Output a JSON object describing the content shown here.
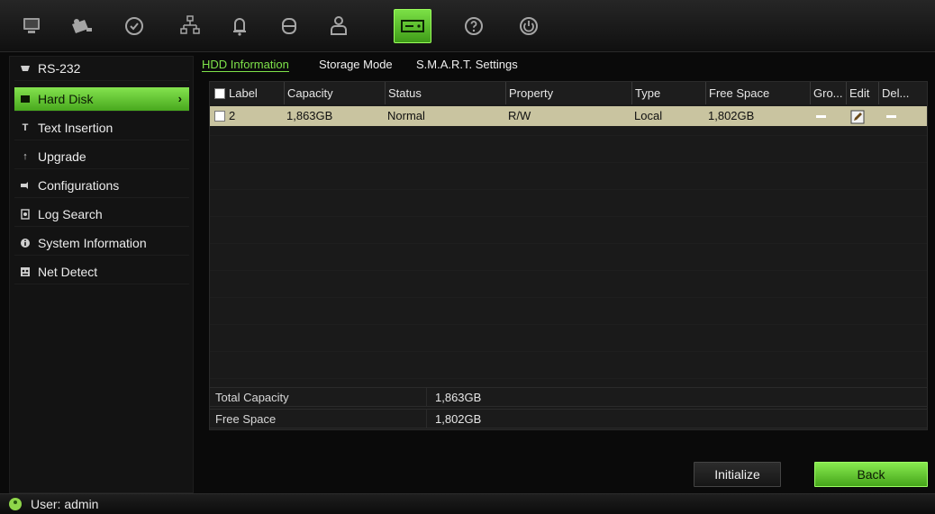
{
  "toolbar": {
    "items": [
      {
        "icon": "display-icon"
      },
      {
        "icon": "camera-icon"
      },
      {
        "icon": "record-icon"
      },
      {
        "icon": "network-icon"
      },
      {
        "icon": "alarm-bell-icon"
      },
      {
        "icon": "device-icon"
      },
      {
        "icon": "user-icon"
      },
      {
        "icon": "storage-icon",
        "active": true
      },
      {
        "icon": "help-icon"
      },
      {
        "icon": "power-icon"
      }
    ]
  },
  "sidebar": {
    "items": [
      {
        "label": "RS-232",
        "icon": "serial-port-icon"
      },
      {
        "label": "Hard Disk",
        "icon": "hard-disk-icon",
        "active": true
      },
      {
        "label": "Text Insertion",
        "icon": "text-icon"
      },
      {
        "label": "Upgrade",
        "icon": "upgrade-icon"
      },
      {
        "label": "Configurations",
        "icon": "config-icon"
      },
      {
        "label": "Log Search",
        "icon": "log-icon"
      },
      {
        "label": "System Information",
        "icon": "info-icon"
      },
      {
        "label": "Net Detect",
        "icon": "net-icon"
      }
    ]
  },
  "tabs": [
    {
      "label": "HDD Information",
      "active": true
    },
    {
      "label": "Storage Mode"
    },
    {
      "label": "S.M.A.R.T. Settings"
    }
  ],
  "table": {
    "headers": [
      "Label",
      "Capacity",
      "Status",
      "Property",
      "Type",
      "Free Space",
      "Gro...",
      "Edit",
      "Del..."
    ],
    "rows": [
      {
        "label": "2",
        "capacity": "1,863GB",
        "status": "Normal",
        "property": "R/W",
        "type": "Local",
        "free_space": "1,802GB"
      }
    ]
  },
  "summary": {
    "total_capacity_label": "Total Capacity",
    "total_capacity_value": "1,863GB",
    "free_space_label": "Free Space",
    "free_space_value": "1,802GB"
  },
  "buttons": {
    "initialize": "Initialize",
    "back": "Back"
  },
  "status": {
    "user": "User: admin"
  },
  "colors": {
    "accent": "#7ee24a",
    "selected_row": "#c9c4a0"
  }
}
